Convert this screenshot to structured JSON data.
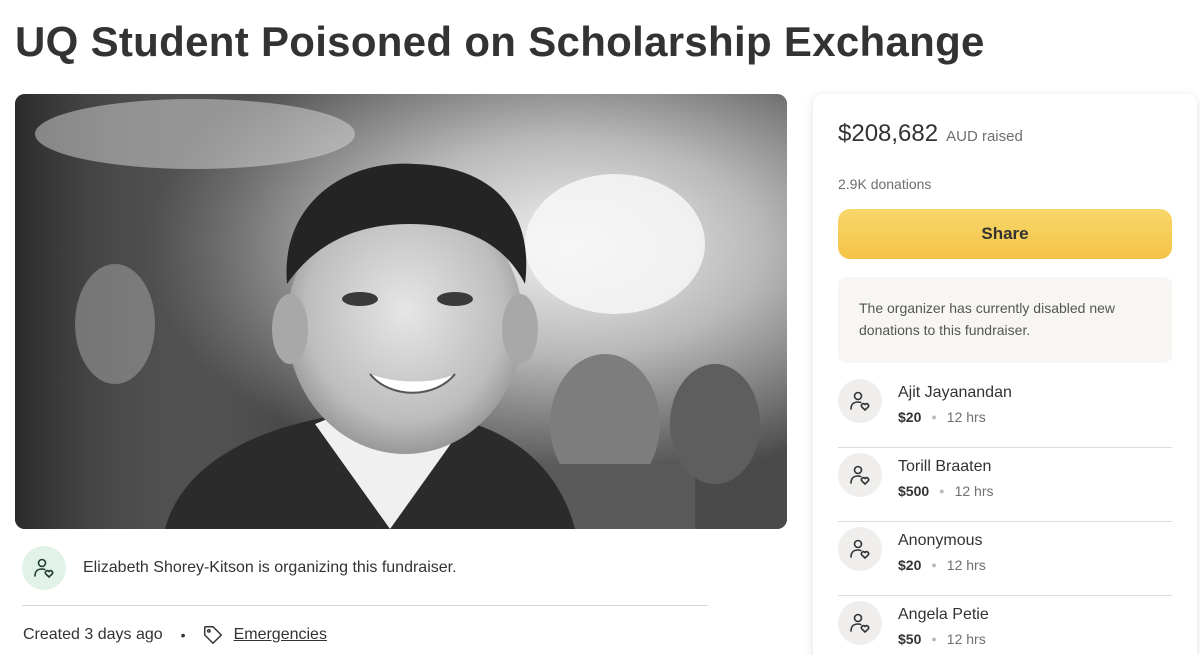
{
  "title": "UQ Student Poisoned on Scholarship Exchange",
  "hero_image": {
    "icon": "portrait-photo"
  },
  "organizer": {
    "text": "Elizabeth Shorey-Kitson is organizing this fundraiser.",
    "icon": "person-heart-icon"
  },
  "meta": {
    "created": "Created 3 days ago",
    "separator": "•",
    "category": "Emergencies",
    "category_icon": "tag-icon"
  },
  "card": {
    "amount": "$208,682",
    "amount_suffix": "AUD raised",
    "donations": "2.9K donations",
    "share_label": "Share",
    "notice": "The organizer has currently disabled new donations to this fundraiser.",
    "donors": [
      {
        "name": "Ajit Jayanandan",
        "amount": "$20",
        "time": "12 hrs"
      },
      {
        "name": "Torill Braaten",
        "amount": "$500",
        "time": "12 hrs"
      },
      {
        "name": "Anonymous",
        "amount": "$20",
        "time": "12 hrs"
      },
      {
        "name": "Angela Petie",
        "amount": "$50",
        "time": "12 hrs"
      }
    ]
  },
  "colors": {
    "share_button": "#f4c346",
    "organizer_avatar_bg": "#e1f2e8",
    "donor_avatar_bg": "#efeeec",
    "notice_bg": "#f8f6f2",
    "text": "#333333"
  }
}
